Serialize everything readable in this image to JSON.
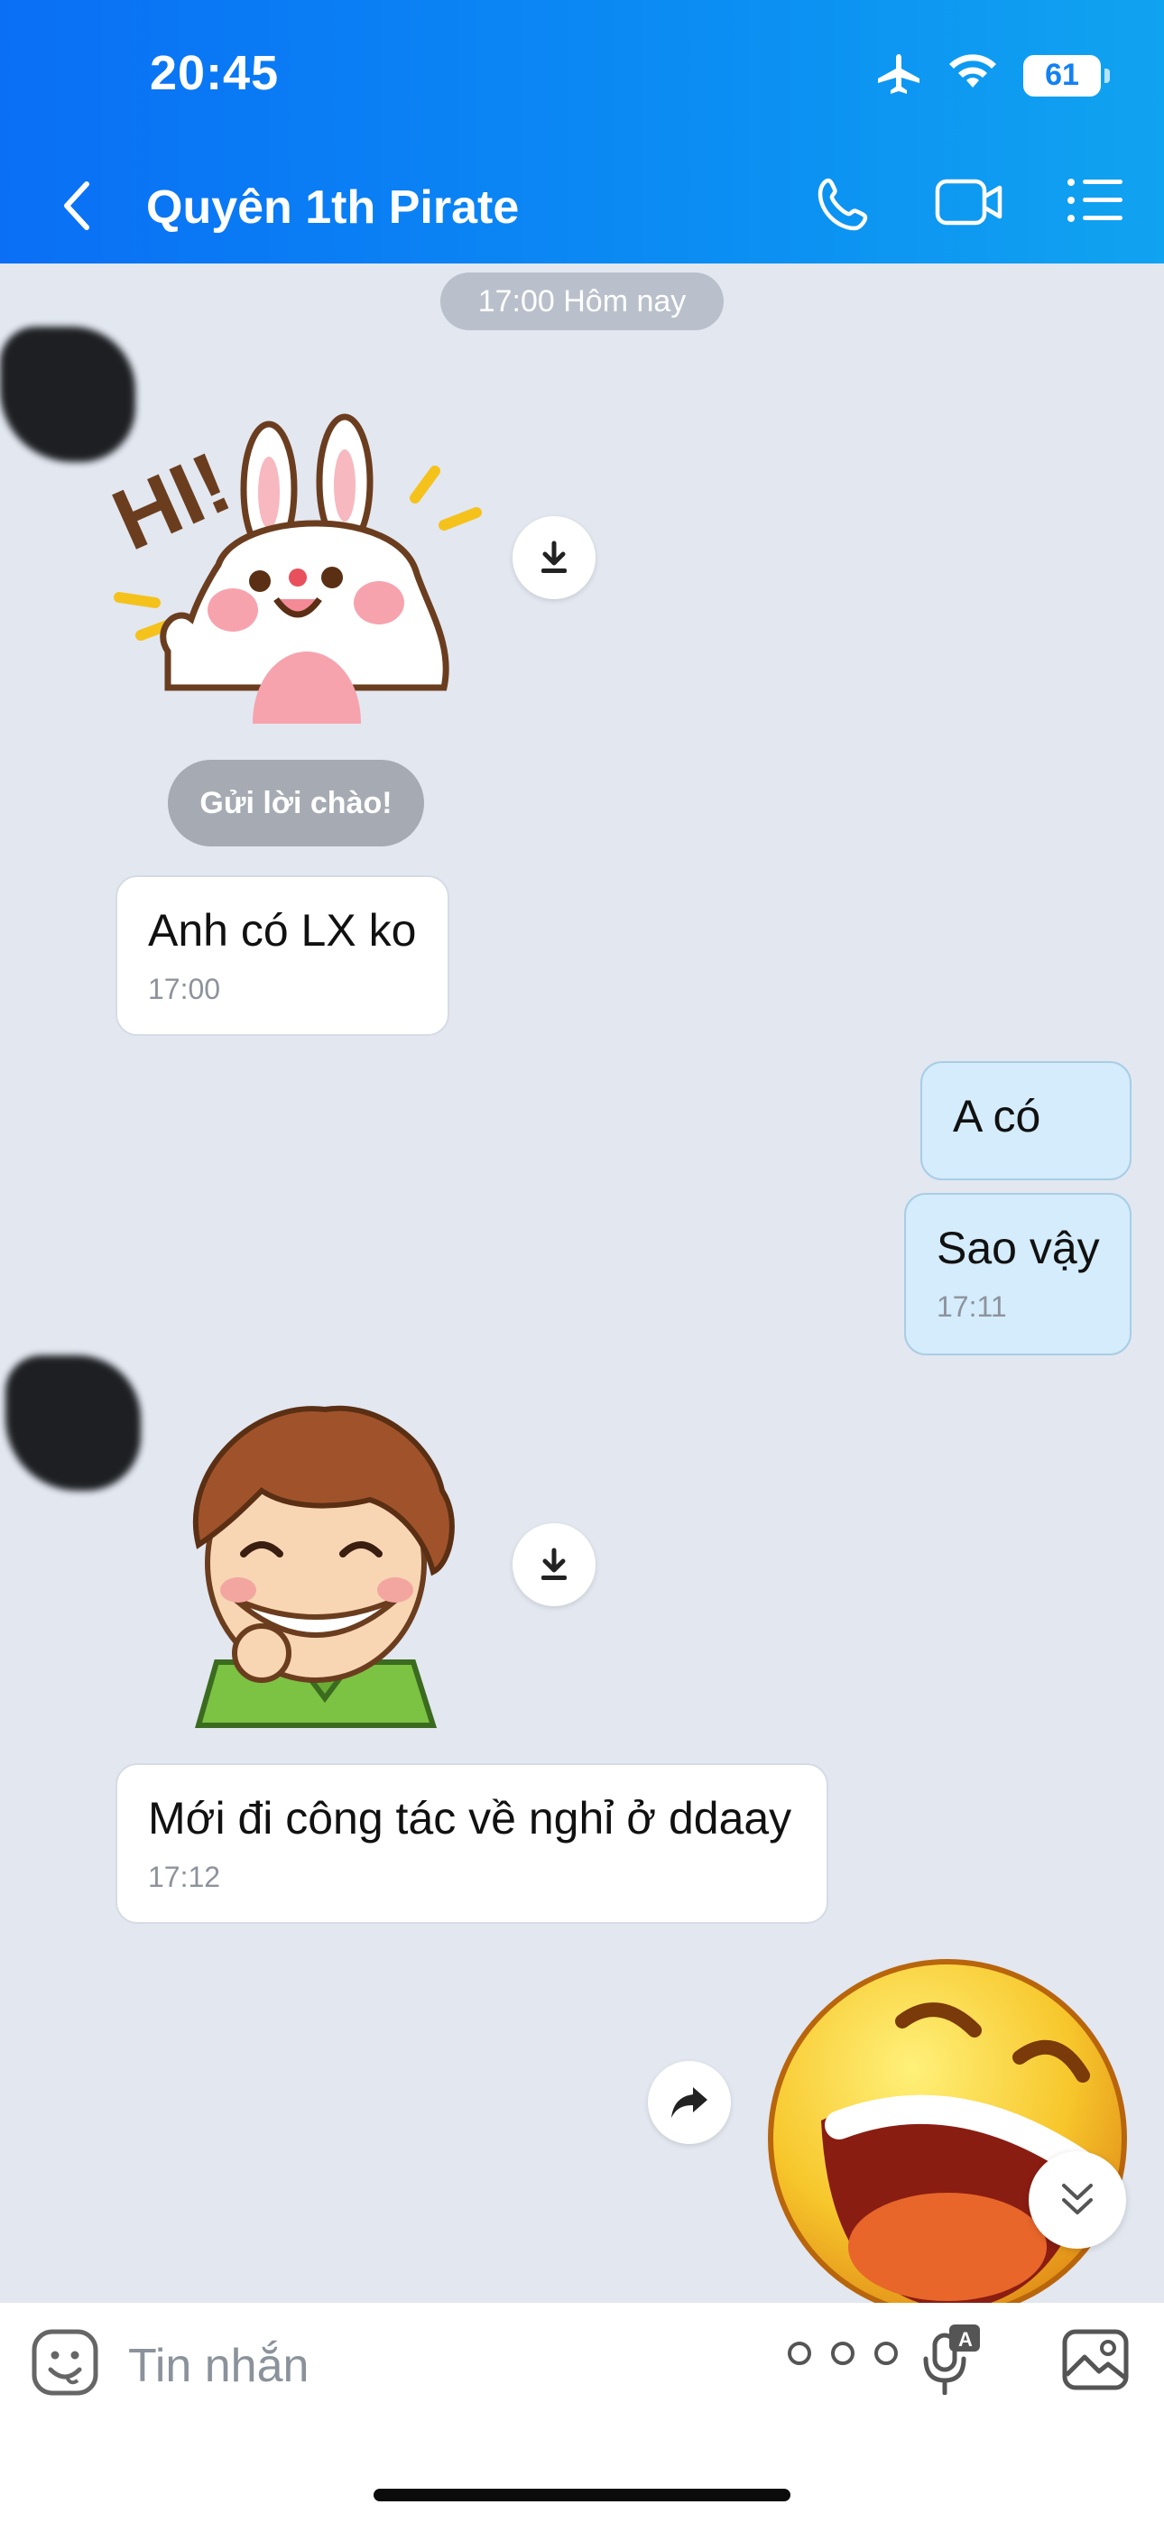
{
  "status": {
    "time": "20:45",
    "battery": "61"
  },
  "header": {
    "title": "Quyên 1th Pirate"
  },
  "chat": {
    "time_divider": "17:00 Hôm nay",
    "greeting_chip": "Gửi lời chào!",
    "messages": [
      {
        "text": "Anh có LX ko",
        "time": "17:00"
      },
      {
        "text": "A có"
      },
      {
        "text": "Sao vậy",
        "time": "17:11"
      },
      {
        "text": "Mới đi công tác về nghỉ ở ddaay",
        "time": "17:12"
      }
    ],
    "stickers": [
      {
        "name": "hi-bunny-sticker",
        "text": "HI!"
      },
      {
        "name": "grinning-boy-sticker"
      },
      {
        "name": "laughing-emoji-sticker"
      }
    ]
  },
  "input": {
    "placeholder": "Tin nhắn"
  },
  "colors": {
    "header_start": "#0a6ff5",
    "header_end": "#10a3f0",
    "chat_bg": "#e2e7f0",
    "outgoing_bubble": "#d4ecfb"
  }
}
